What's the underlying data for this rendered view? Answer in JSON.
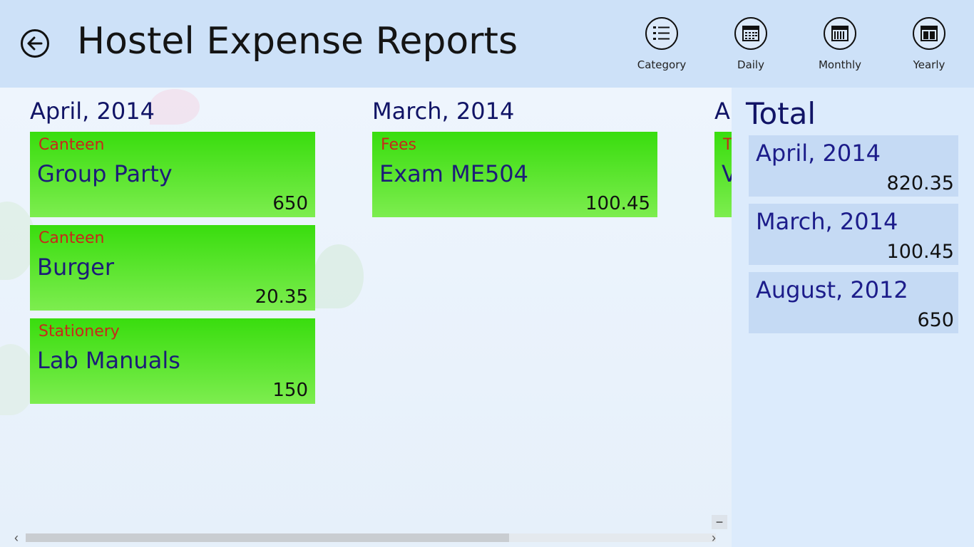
{
  "header": {
    "title": "Hostel Expense Reports",
    "buttons": [
      {
        "label": "Category",
        "icon": "list-icon"
      },
      {
        "label": "Daily",
        "icon": "calendar-day-icon"
      },
      {
        "label": "Monthly",
        "icon": "calendar-month-icon"
      },
      {
        "label": "Yearly",
        "icon": "calendar-year-icon"
      }
    ]
  },
  "groups": [
    {
      "heading": "April, 2014",
      "items": [
        {
          "category": "Canteen",
          "name": "Group Party",
          "amount": "650"
        },
        {
          "category": "Canteen",
          "name": "Burger",
          "amount": "20.35"
        },
        {
          "category": "Stationery",
          "name": "Lab Manuals",
          "amount": "150"
        }
      ]
    },
    {
      "heading": "March, 2014",
      "items": [
        {
          "category": "Fees",
          "name": "Exam ME504",
          "amount": "100.45"
        }
      ]
    },
    {
      "heading": "A",
      "items": [
        {
          "category": "T",
          "name": "V",
          "amount": ""
        }
      ]
    }
  ],
  "totals": {
    "title": "Total",
    "items": [
      {
        "month": "April, 2014",
        "amount": "820.35"
      },
      {
        "month": "March, 2014",
        "amount": "100.45"
      },
      {
        "month": "August, 2012",
        "amount": "650"
      }
    ]
  },
  "scroll": {
    "left_arrow": "‹",
    "right_arrow": "›",
    "zoom": "−",
    "position_fraction": 0.0,
    "visible_fraction": 0.7
  },
  "colors": {
    "tile_green": "#39dd0e",
    "category_red": "#c8281a",
    "heading_navy": "#111466"
  }
}
